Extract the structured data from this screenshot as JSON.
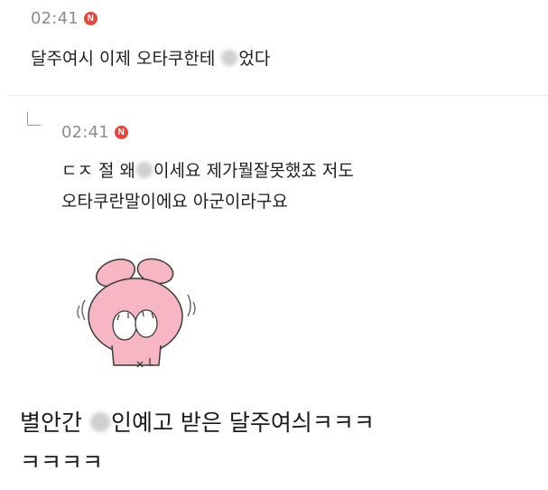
{
  "comment": {
    "time": "02:41",
    "badge": "N",
    "text_before": "달주여시 이제 오타쿠한테 ",
    "text_after": "었다"
  },
  "reply": {
    "time": "02:41",
    "badge": "N",
    "line1_before": "ㄷㅈ 절 왜",
    "line1_after": "이세요 제가뭘잘못했죠 저도",
    "line2": "오타쿠란말이에요 아군이라구요",
    "sticker_icon": "crying-pink-bunny-sticker"
  },
  "caption": {
    "text_before": "별안간 ",
    "text_after": "인예고 받은 달주여싀ㅋㅋㅋ",
    "line2": "ㅋㅋㅋㅋ"
  },
  "colors": {
    "badge": "#e8453c",
    "meta_text": "#8c8c8c",
    "body_text": "#1f1f1f"
  }
}
